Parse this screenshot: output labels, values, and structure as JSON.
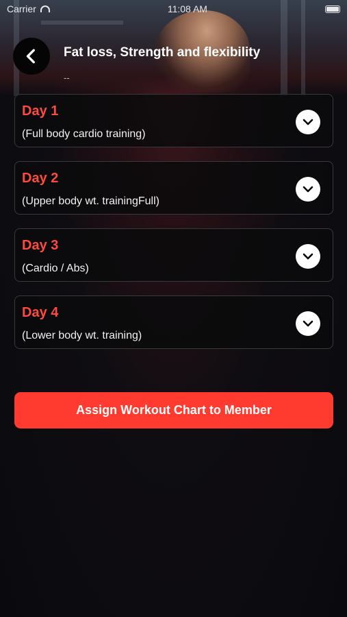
{
  "status_bar": {
    "carrier": "Carrier",
    "time": "11:08 AM"
  },
  "header": {
    "back_icon": "chevron-left-icon",
    "title": "Fat loss, Strength and flexibility",
    "subtitle": "--"
  },
  "days": [
    {
      "title": "Day 1",
      "description": "(Full body cardio training)",
      "icon": "chevron-down-icon"
    },
    {
      "title": "Day 2",
      "description": "(Upper body wt. trainingFull)",
      "icon": "chevron-down-icon"
    },
    {
      "title": "Day 3",
      "description": "(Cardio / Abs)",
      "icon": "chevron-down-icon"
    },
    {
      "title": "Day 4",
      "description": "(Lower body wt. training)",
      "icon": "chevron-down-icon"
    }
  ],
  "assign_button": {
    "label": "Assign Workout Chart to Member"
  },
  "colors": {
    "accent": "#ff3b30",
    "day_title": "#ff4a3d",
    "background": "#0a0a0e"
  }
}
